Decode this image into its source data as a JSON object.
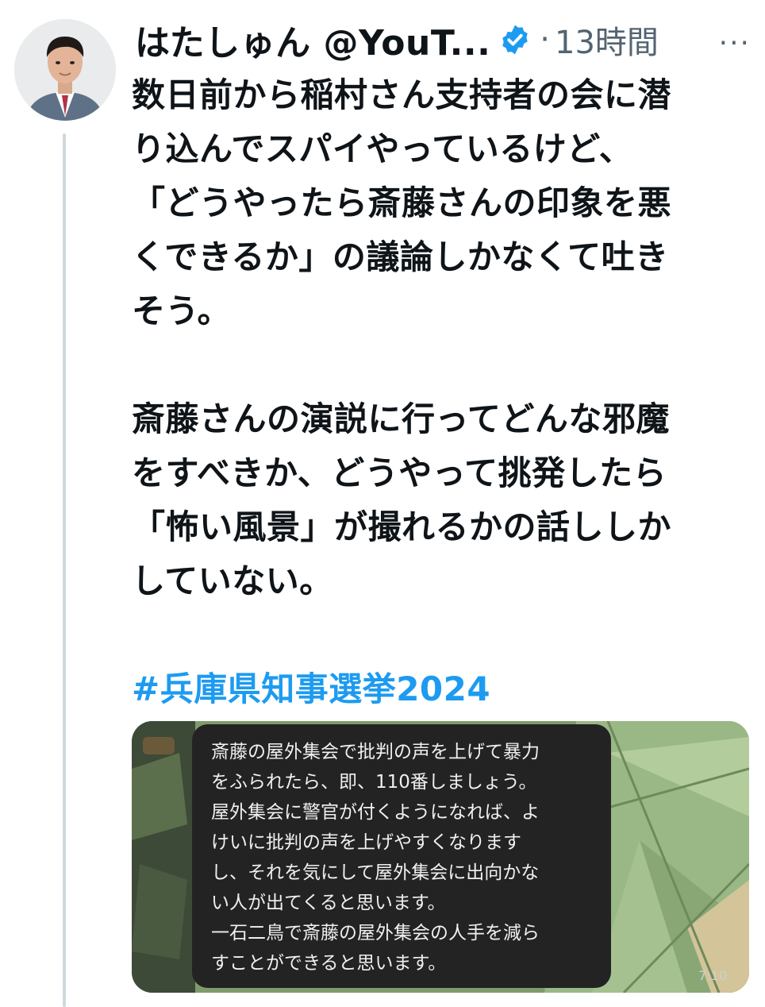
{
  "tweet": {
    "display_name": "はたしゅん @YouT...",
    "separator": "·",
    "time": "13時間",
    "more_label": "···",
    "text_lines_1": [
      "数日前から稲村さん支持者の会に潜",
      "り込んでスパイやっているけど、",
      "「どうやったら斎藤さんの印象を悪",
      "くできるか」の議論しかなくて吐き",
      "そう。"
    ],
    "text_lines_2": [
      "斎藤さんの演説に行ってどんな邪魔",
      "をすべきか、どうやって挑発したら",
      "「怖い風景」が撮れるかの話ししか",
      "していない。"
    ],
    "hashtag": "#兵庫県知事選挙2024"
  },
  "media": {
    "message_lines": [
      "斎藤の屋外集会で批判の声を上げて暴力",
      "をふられたら、即、110番しましょう。",
      "屋外集会に警官が付くようになれば、よ",
      "けいに批判の声を上げやすくなります",
      "し、それを気にして屋外集会に出向かな",
      "い人が出てくると思います。",
      "一石二鳥で斎藤の屋外集会の人手を減ら",
      "すことができると思います。"
    ],
    "message_time": "7:10"
  },
  "colors": {
    "hashtag": "#1d9bf0",
    "verified_badge": "#1d9bf0",
    "secondary_text": "#536471",
    "message_bubble": "#232323",
    "media_background": "#7e9a6b"
  },
  "icons": {
    "verified": "verified-badge-icon",
    "more": "more-icon"
  }
}
